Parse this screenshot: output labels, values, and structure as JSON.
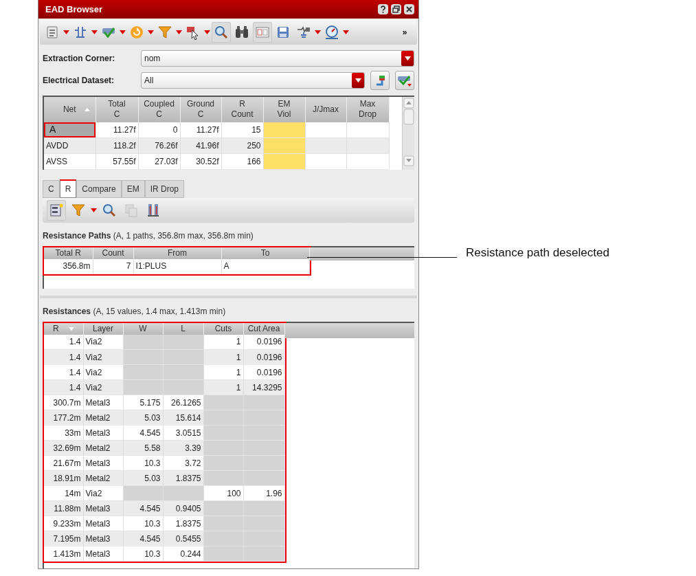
{
  "window": {
    "title": "EAD Browser"
  },
  "toolbar": [
    {
      "kind": "list",
      "menu": true,
      "pressed": false
    },
    {
      "kind": "circuit",
      "menu": true,
      "pressed": false
    },
    {
      "kind": "check",
      "menu": true,
      "pressed": false
    },
    {
      "kind": "refresh",
      "menu": true,
      "pressed": false
    },
    {
      "kind": "filter",
      "menu": true,
      "pressed": false
    },
    {
      "kind": "cursor",
      "menu": true,
      "pressed": false
    },
    {
      "kind": "zoom",
      "menu": false,
      "pressed": true
    },
    {
      "kind": "binoculars",
      "menu": false,
      "pressed": false
    },
    {
      "kind": "panel",
      "menu": false,
      "pressed": true
    },
    {
      "kind": "save",
      "menu": false,
      "pressed": false
    },
    {
      "kind": "component",
      "menu": true,
      "pressed": false
    },
    {
      "kind": "gauge",
      "menu": true,
      "pressed": false
    }
  ],
  "toolbar_overflow": "»",
  "extraction_corner": {
    "label": "Extraction Corner:",
    "value": "nom"
  },
  "electrical_dataset": {
    "label": "Electrical Dataset:",
    "value": "All"
  },
  "nets_table": {
    "columns": [
      {
        "label": "Net",
        "sort_descending": false,
        "highlighted": false
      },
      {
        "label": "Total C",
        "highlighted": false
      },
      {
        "label": "Coupled C",
        "highlighted": false
      },
      {
        "label": "Ground C",
        "highlighted": false
      },
      {
        "label": "R Count",
        "highlighted": false
      },
      {
        "label": "EM Viol",
        "highlighted": true
      },
      {
        "label": "J/Jmax",
        "highlighted": false
      },
      {
        "label": "Max Drop",
        "highlighted": false
      }
    ],
    "rows": [
      {
        "selected": true,
        "annotated": true,
        "cells": [
          "A",
          "11.27f",
          "0",
          "11.27f",
          "15"
        ]
      },
      {
        "selected": false,
        "annotated": false,
        "cells": [
          "AVDD",
          "118.2f",
          "76.26f",
          "41.96f",
          "250"
        ]
      },
      {
        "selected": false,
        "annotated": false,
        "cells": [
          "AVSS",
          "57.55f",
          "27.03f",
          "30.52f",
          "166"
        ]
      }
    ]
  },
  "tabs": [
    {
      "label": "C",
      "selected": false
    },
    {
      "label": "R",
      "selected": true
    },
    {
      "label": "Compare",
      "selected": false
    },
    {
      "label": "EM",
      "selected": false
    },
    {
      "label": "IR Drop",
      "selected": false
    }
  ],
  "sub_toolbar": [
    {
      "kind": "select",
      "menu": false,
      "pressed": true,
      "disabled": false
    },
    {
      "kind": "filter",
      "menu": true,
      "pressed": false,
      "disabled": false
    },
    {
      "kind": "zoom",
      "menu": false,
      "pressed": false,
      "disabled": false
    },
    {
      "kind": "copy",
      "menu": false,
      "pressed": false,
      "disabled": true
    },
    {
      "kind": "columns",
      "menu": false,
      "pressed": false,
      "disabled": false
    }
  ],
  "resistance_paths": {
    "heading": "**Resistance Paths** (A, 1 paths, 356.8m max, 356.8m min)",
    "annotated": true,
    "columns": [
      "Total R",
      "Count",
      "From",
      "To"
    ],
    "rows": [
      [
        "356.8m",
        "7",
        "I1:PLUS",
        "A"
      ]
    ]
  },
  "resistances": {
    "heading": "**Resistances** (A, 15 values, 1.4 max, 1.413m min)",
    "annotated": true,
    "columns": [
      {
        "label": "R",
        "sort_descending": true
      },
      {
        "label": "Layer"
      },
      {
        "label": "W"
      },
      {
        "label": "L"
      },
      {
        "label": "Cuts"
      },
      {
        "label": "Cut Area"
      }
    ],
    "rows": [
      {
        "r": "1.4",
        "layer": "Via2",
        "cuts": "1",
        "cut_area": "0.0196"
      },
      {
        "r": "1.4",
        "layer": "Via2",
        "cuts": "1",
        "cut_area": "0.0196"
      },
      {
        "r": "1.4",
        "layer": "Via2",
        "cuts": "1",
        "cut_area": "0.0196"
      },
      {
        "r": "1.4",
        "layer": "Via2",
        "cuts": "1",
        "cut_area": "14.3295"
      },
      {
        "r": "300.7m",
        "layer": "Metal3",
        "w": "5.175",
        "l": "26.1265"
      },
      {
        "r": "177.2m",
        "layer": "Metal2",
        "w": "5.03",
        "l": "15.614"
      },
      {
        "r": "33m",
        "layer": "Metal3",
        "w": "4.545",
        "l": "3.0515"
      },
      {
        "r": "32.69m",
        "layer": "Metal2",
        "w": "5.58",
        "l": "3.39"
      },
      {
        "r": "21.67m",
        "layer": "Metal3",
        "w": "10.3",
        "l": "3.72"
      },
      {
        "r": "18.91m",
        "layer": "Metal2",
        "w": "5.03",
        "l": "1.8375"
      },
      {
        "r": "14m",
        "layer": "Via2",
        "cuts": "100",
        "cut_area": "1.96"
      },
      {
        "r": "11.88m",
        "layer": "Metal3",
        "w": "4.545",
        "l": "0.9405"
      },
      {
        "r": "9.233m",
        "layer": "Metal3",
        "w": "10.3",
        "l": "1.8375"
      },
      {
        "r": "7.195m",
        "layer": "Metal3",
        "w": "4.545",
        "l": "0.5455"
      },
      {
        "r": "1.413m",
        "layer": "Metal3",
        "w": "10.3",
        "l": "0.244"
      }
    ]
  },
  "callout": "Resistance path deselected"
}
